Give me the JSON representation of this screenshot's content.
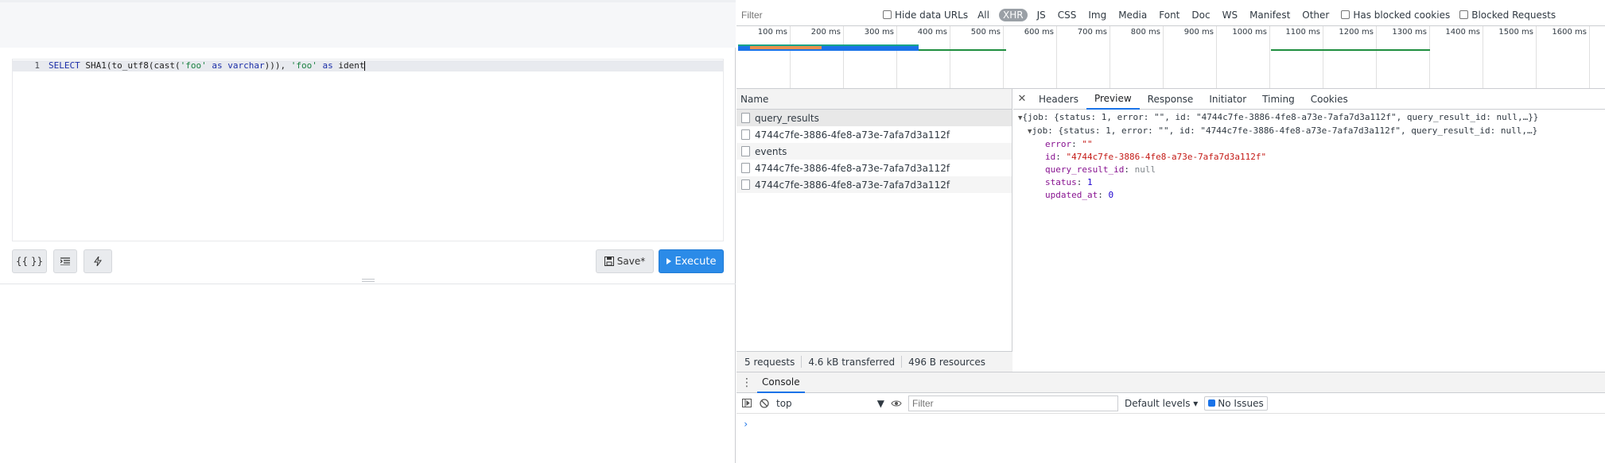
{
  "editor": {
    "line_number": "1",
    "code": {
      "kw_select": "SELECT",
      "fn_sha1": " SHA1(to_utf8(cast(",
      "str_foo1": "'foo'",
      "kw_as1": " as ",
      "kw_varchar": "varchar",
      "fn_close": "))), ",
      "str_foo2": "'foo'",
      "kw_as2": " as ",
      "ident": "ident"
    }
  },
  "toolbar": {
    "format_label": "{{ }}",
    "save_label": "Save*",
    "execute_label": "Execute"
  },
  "devtools": {
    "filter_placeholder": "Filter",
    "hide_data_urls": "Hide data URLs",
    "type_filters": [
      "All",
      "XHR",
      "JS",
      "CSS",
      "Img",
      "Media",
      "Font",
      "Doc",
      "WS",
      "Manifest",
      "Other"
    ],
    "active_type": "XHR",
    "has_blocked_cookies": "Has blocked cookies",
    "blocked_requests": "Blocked Requests",
    "timeline_ticks": [
      "100 ms",
      "200 ms",
      "300 ms",
      "400 ms",
      "500 ms",
      "600 ms",
      "700 ms",
      "800 ms",
      "900 ms",
      "1000 ms",
      "1100 ms",
      "1200 ms",
      "1300 ms",
      "1400 ms",
      "1500 ms",
      "1600 ms"
    ],
    "requests_header": "Name",
    "requests": [
      "query_results",
      "4744c7fe-3886-4fe8-a73e-7afa7d3a112f",
      "events",
      "4744c7fe-3886-4fe8-a73e-7afa7d3a112f",
      "4744c7fe-3886-4fe8-a73e-7afa7d3a112f"
    ],
    "status": {
      "requests": "5 requests",
      "transferred": "4.6 kB transferred",
      "resources": "496 B resources"
    },
    "detail_tabs": [
      "Headers",
      "Preview",
      "Response",
      "Initiator",
      "Timing",
      "Cookies"
    ],
    "active_detail_tab": "Preview",
    "preview": {
      "line1": "{job: {status: 1, error: \"\", id: \"4744c7fe-3886-4fe8-a73e-7afa7d3a112f\", query_result_id: null,…}}",
      "line2": "job: {status: 1, error: \"\", id: \"4744c7fe-3886-4fe8-a73e-7afa7d3a112f\", query_result_id: null,…}",
      "error_key": "error",
      "error_val": "\"\"",
      "id_key": "id",
      "id_val": "\"4744c7fe-3886-4fe8-a73e-7afa7d3a112f\"",
      "qr_key": "query_result_id",
      "qr_val": "null",
      "status_key": "status",
      "status_val": "1",
      "updated_key": "updated_at",
      "updated_val": "0"
    },
    "console": {
      "tab": "Console",
      "context": "top",
      "filter_placeholder": "Filter",
      "levels": "Default levels",
      "issues": "No Issues",
      "prompt": "›"
    }
  },
  "colors": {
    "execute": "#2b8be8",
    "accent": "#1a73e8"
  }
}
